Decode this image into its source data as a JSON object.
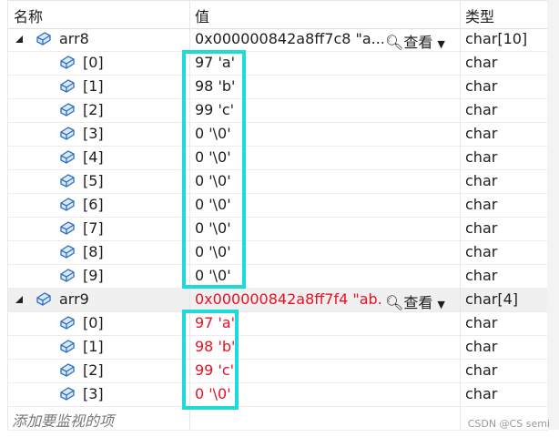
{
  "header": {
    "name": "名称",
    "value": "值",
    "type": "类型"
  },
  "view_label": "查看",
  "groups": [
    {
      "name": "arr8",
      "value": "0x000000842a8ff7c8 \"a...",
      "type": "char[10]",
      "changed": false,
      "items": [
        {
          "name": "[0]",
          "value": "97 'a'",
          "type": "char"
        },
        {
          "name": "[1]",
          "value": "98 'b'",
          "type": "char"
        },
        {
          "name": "[2]",
          "value": "99 'c'",
          "type": "char"
        },
        {
          "name": "[3]",
          "value": "0 '\\0'",
          "type": "char"
        },
        {
          "name": "[4]",
          "value": "0 '\\0'",
          "type": "char"
        },
        {
          "name": "[5]",
          "value": "0 '\\0'",
          "type": "char"
        },
        {
          "name": "[6]",
          "value": "0 '\\0'",
          "type": "char"
        },
        {
          "name": "[7]",
          "value": "0 '\\0'",
          "type": "char"
        },
        {
          "name": "[8]",
          "value": "0 '\\0'",
          "type": "char"
        },
        {
          "name": "[9]",
          "value": "0 '\\0'",
          "type": "char"
        }
      ]
    },
    {
      "name": "arr9",
      "value": "0x000000842a8ff7f4 \"ab...",
      "type": "char[4]",
      "changed": true,
      "items": [
        {
          "name": "[0]",
          "value": "97 'a'",
          "type": "char"
        },
        {
          "name": "[1]",
          "value": "98 'b'",
          "type": "char"
        },
        {
          "name": "[2]",
          "value": "99 'c'",
          "type": "char"
        },
        {
          "name": "[3]",
          "value": "0 '\\0'",
          "type": "char"
        }
      ]
    }
  ],
  "add_placeholder": "添加要监视的项",
  "watermark": "CSDN @CS semi",
  "colors": {
    "highlight": "#1ddbdb",
    "changed": "#e81123"
  }
}
